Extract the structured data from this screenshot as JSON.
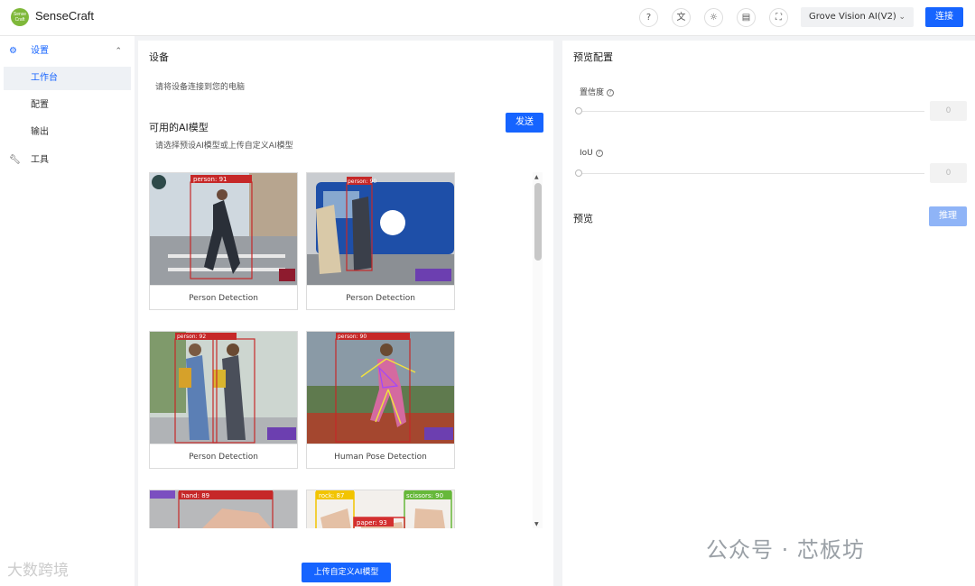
{
  "header": {
    "logo_text": "Sense Craft",
    "app_title": "SenseCraft",
    "icons": [
      "help-icon",
      "translate-icon",
      "theme-icon",
      "document-icon",
      "fullscreen-icon"
    ],
    "device": "Grove Vision AI(V2)",
    "connect_label": "连接",
    "accent": "#1664ff"
  },
  "sidebar": {
    "settings_label": "设置",
    "workbench_label": "工作台",
    "config_label": "配置",
    "output_label": "输出",
    "tools_label": "工具"
  },
  "main": {
    "device_title": "设备",
    "device_hint": "请将设备连接到您的电脑",
    "models_title": "可用的AI模型",
    "models_hint": "请选择预设AI模型或上传自定义AI模型",
    "send_label": "发送",
    "upload_label": "上传自定义AI模型",
    "cards": [
      {
        "caption": "Person Detection",
        "tag": "person: 91"
      },
      {
        "caption": "Person Detection",
        "tag": "person: 90"
      },
      {
        "caption": "Person Detection",
        "tag": "person: 92"
      },
      {
        "caption": "Human Pose Detection",
        "tag": "person: 90"
      },
      {
        "caption": "",
        "tag": "hand: 89"
      },
      {
        "caption": "",
        "tag": "rock: 87",
        "tag2": "scissors: 90",
        "tag3": "paper: 93"
      }
    ]
  },
  "right": {
    "title": "预览配置",
    "confidence_label": "置信度",
    "confidence_value": "0",
    "iou_label": "IoU",
    "iou_value": "0",
    "preview_title": "预览",
    "infer_label": "推理"
  },
  "watermark": {
    "wechat": "公众号 · 芯板坊",
    "left": "大数跨境"
  }
}
